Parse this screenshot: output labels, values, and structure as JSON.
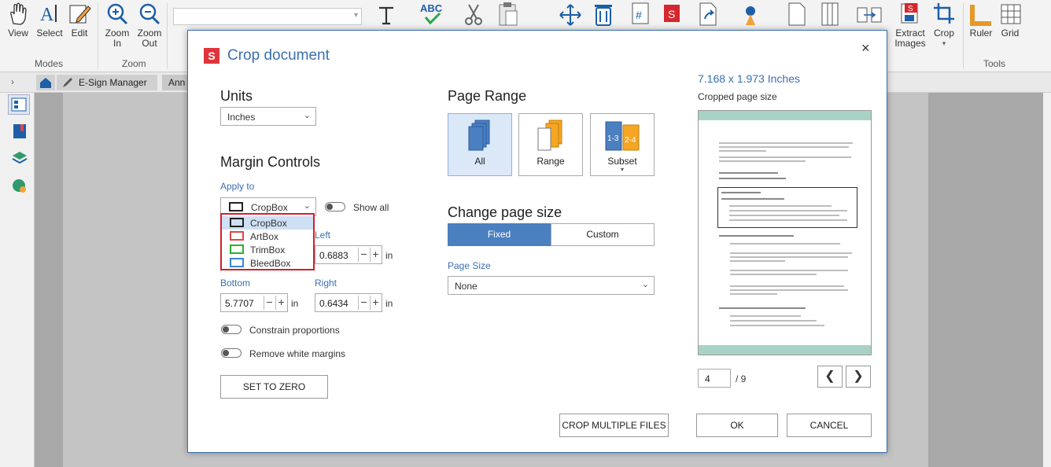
{
  "ribbon": {
    "buttons": [
      {
        "label": "View",
        "icon": "hand-icon"
      },
      {
        "label": "Select",
        "icon": "text-select-icon"
      },
      {
        "label": "Edit",
        "icon": "edit-icon"
      },
      {
        "label": "Zoom\nIn",
        "icon": "zoom-in-icon"
      },
      {
        "label": "Zoom\nOut",
        "icon": "zoom-out-icon"
      },
      {
        "label": "Extract\nImages",
        "icon": "extract-images-icon"
      },
      {
        "label": "Crop",
        "icon": "crop-icon"
      },
      {
        "label": "Ruler",
        "icon": "ruler-icon"
      },
      {
        "label": "Grid",
        "icon": "grid-icon"
      }
    ],
    "groups": {
      "modes": "Modes",
      "zoom": "Zoom",
      "tools": "Tools"
    }
  },
  "tabs": {
    "esign": "E-Sign Manager",
    "annot": "Ann"
  },
  "dialog": {
    "title": "Crop document",
    "close": "×",
    "units": {
      "heading": "Units",
      "value": "Inches"
    },
    "margin": {
      "heading": "Margin Controls",
      "apply_to": "Apply to",
      "apply_value": "CropBox",
      "show_all": "Show all",
      "options": [
        {
          "label": "CropBox",
          "color": "#222222"
        },
        {
          "label": "ArtBox",
          "color": "#e04848"
        },
        {
          "label": "TrimBox",
          "color": "#2bb02b"
        },
        {
          "label": "BleedBox",
          "color": "#3a86e0"
        }
      ],
      "left_label": "Left",
      "left_value": "0.6883",
      "bottom_label": "Bottom",
      "bottom_value": "5.7707",
      "right_label": "Right",
      "right_value": "0.6434",
      "unit": "in",
      "constrain": "Constrain proportions",
      "remove_white": "Remove white margins",
      "set_zero": "SET TO ZERO"
    },
    "page_range": {
      "heading": "Page Range",
      "all": "All",
      "range": "Range",
      "subset": "Subset"
    },
    "page_size": {
      "heading": "Change page size",
      "fixed": "Fixed",
      "custom": "Custom",
      "size_label": "Page Size",
      "size_value": "None"
    },
    "preview": {
      "dimensions": "7.168 x 1.973 Inches",
      "caption": "Cropped page size",
      "page": "4",
      "total": "/ 9"
    },
    "buttons": {
      "crop_multiple": "CROP MULTIPLE FILES",
      "ok": "OK",
      "cancel": "CANCEL"
    },
    "logo": "S"
  },
  "colors": {
    "accent": "#3a6fb0",
    "selected_seg": "#4a7fc0",
    "logo_red": "#e0343a"
  }
}
